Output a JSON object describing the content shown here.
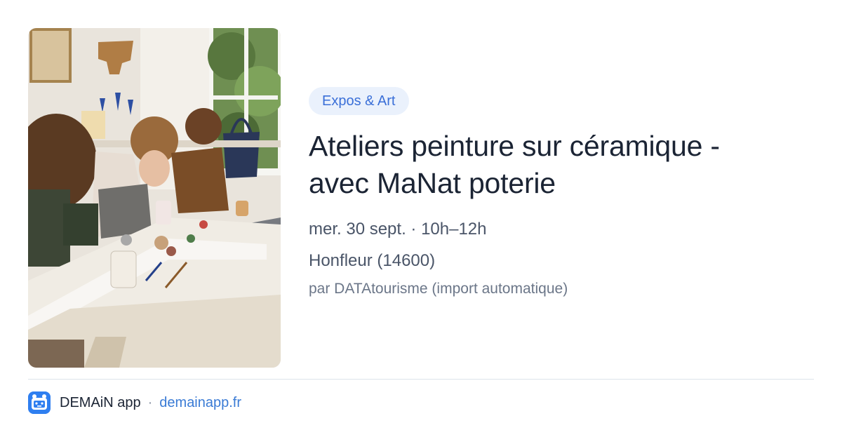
{
  "event": {
    "category": "Expos & Art",
    "title_line1": "Ateliers peinture sur céramique -",
    "title_line2": "avec MaNat poterie",
    "date_time": "mer. 30 sept. · 10h–12h",
    "location": "Honfleur (14600)",
    "source": "par DATAtourisme (import automatique)"
  },
  "footer": {
    "app_name": "DEMAiN app",
    "separator": "·",
    "domain": "demainapp.fr"
  },
  "icons": {
    "app_logo": "demain-app-logo-icon"
  },
  "colors": {
    "accent": "#3a7bd5",
    "category_bg": "#eaf1fc",
    "title": "#1b2434",
    "muted": "#4a5568"
  }
}
